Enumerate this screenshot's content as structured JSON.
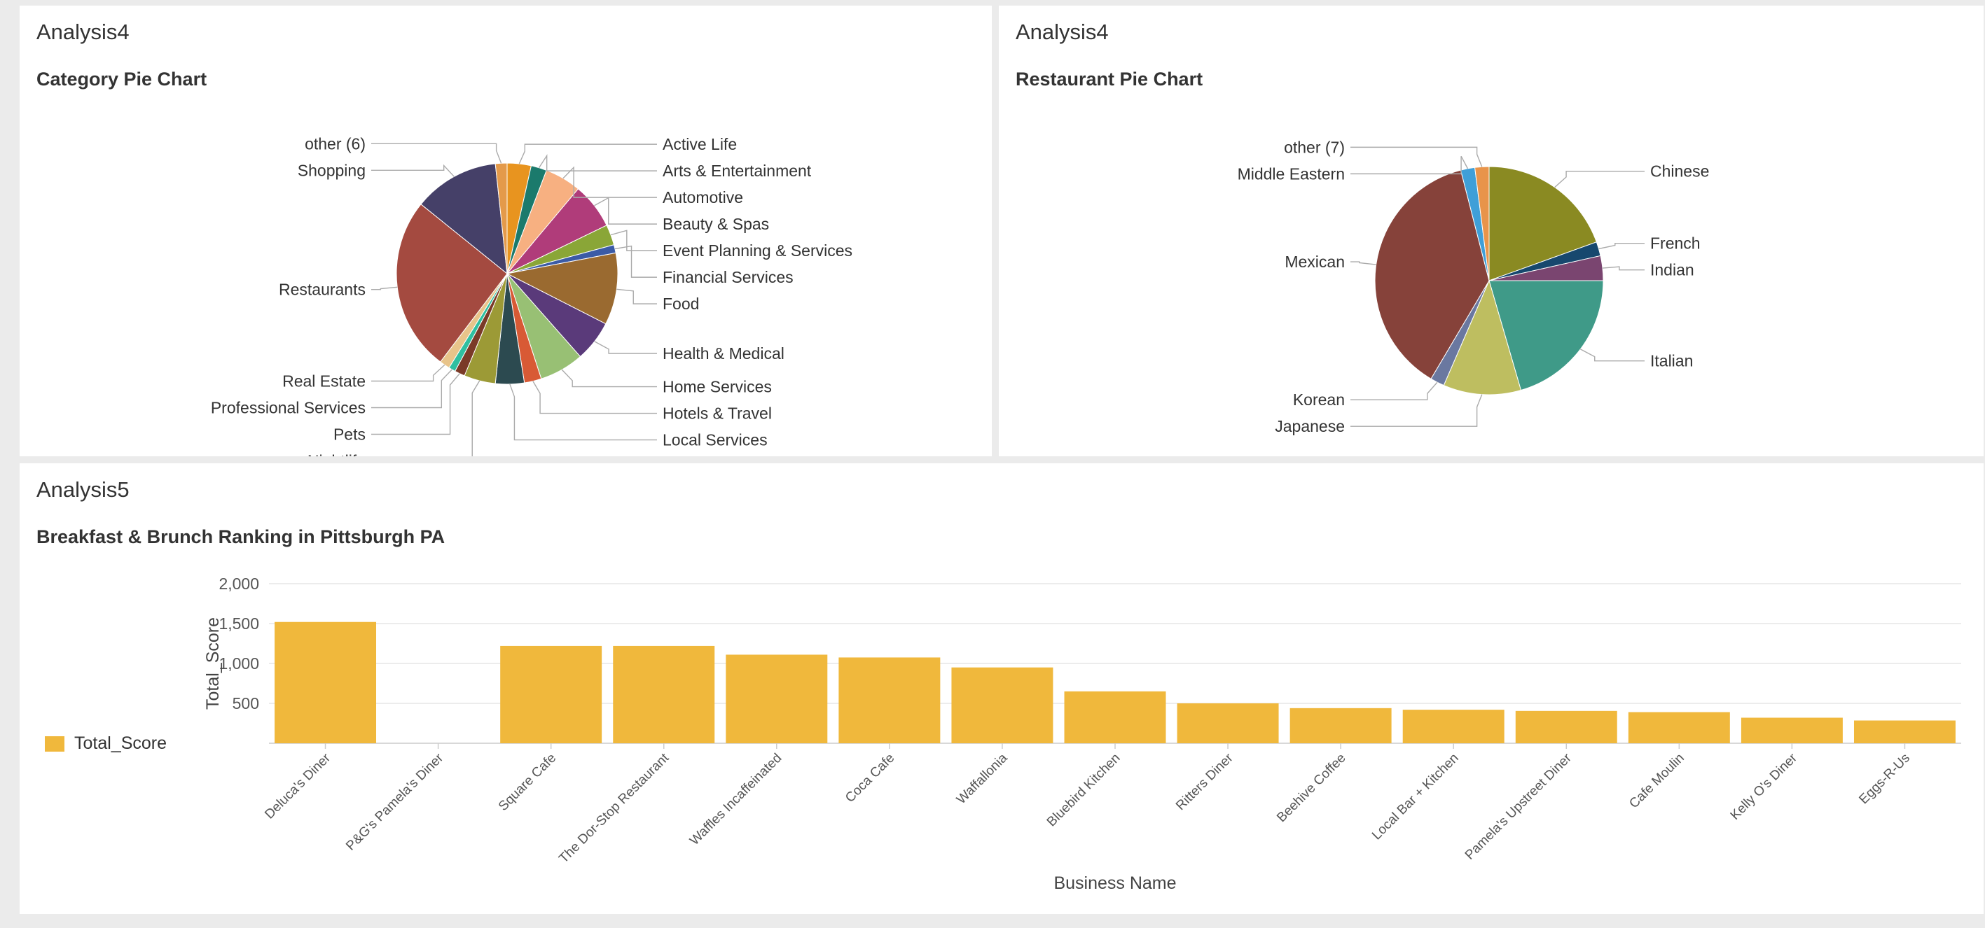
{
  "panels": {
    "category": {
      "header": "Analysis4"
    },
    "restaurant": {
      "header": "Analysis4"
    },
    "ranking": {
      "header": "Analysis5"
    }
  },
  "chart_data": [
    {
      "type": "pie",
      "title": "Category Pie Chart",
      "slices": [
        {
          "label": "Active Life",
          "value": 3.5,
          "color": "#e8941f"
        },
        {
          "label": "Arts & Entertainment",
          "value": 2.3,
          "color": "#1b7a6c"
        },
        {
          "label": "Automotive",
          "value": 5.3,
          "color": "#f7b081"
        },
        {
          "label": "Beauty & Spas",
          "value": 6.7,
          "color": "#b03c7a"
        },
        {
          "label": "Event Planning & Services",
          "value": 3.0,
          "color": "#8aa637"
        },
        {
          "label": "Financial Services",
          "value": 1.2,
          "color": "#3b5ba6"
        },
        {
          "label": "Food",
          "value": 10.5,
          "color": "#9a6a30"
        },
        {
          "label": "Health & Medical",
          "value": 6.0,
          "color": "#5a3a7a"
        },
        {
          "label": "Home Services",
          "value": 6.5,
          "color": "#98c074"
        },
        {
          "label": "Hotels & Travel",
          "value": 2.5,
          "color": "#d85a35"
        },
        {
          "label": "Local Services",
          "value": 4.2,
          "color": "#2c4a50"
        },
        {
          "label": "Nightlife",
          "value": 4.6,
          "color": "#9c9a36"
        },
        {
          "label": "Pets",
          "value": 1.5,
          "color": "#7a3a28"
        },
        {
          "label": "Professional Services",
          "value": 1.0,
          "color": "#2fbfa0"
        },
        {
          "label": "Real Estate",
          "value": 1.5,
          "color": "#e8c48a"
        },
        {
          "label": "Restaurants",
          "value": 25.5,
          "color": "#a44a40"
        },
        {
          "label": "Shopping",
          "value": 12.5,
          "color": "#454068"
        },
        {
          "label": "other (6)",
          "value": 1.7,
          "color": "#e49a4a"
        }
      ]
    },
    {
      "type": "pie",
      "title": "Restaurant Pie Chart",
      "slices": [
        {
          "label": "Chinese",
          "value": 19.5,
          "color": "#8a8a22"
        },
        {
          "label": "French",
          "value": 2.0,
          "color": "#17486e"
        },
        {
          "label": "Indian",
          "value": 3.5,
          "color": "#7a4570"
        },
        {
          "label": "Italian",
          "value": 20.5,
          "color": "#3f9a88"
        },
        {
          "label": "Japanese",
          "value": 11.0,
          "color": "#bebe60"
        },
        {
          "label": "Korean",
          "value": 2.0,
          "color": "#6a78a0"
        },
        {
          "label": "Mexican",
          "value": 37.5,
          "color": "#86423a"
        },
        {
          "label": "Middle Eastern",
          "value": 2.0,
          "color": "#3f9fd8"
        },
        {
          "label": "other (7)",
          "value": 2.0,
          "color": "#e8944a"
        }
      ]
    },
    {
      "type": "bar",
      "title": "Breakfast & Brunch Ranking in Pittsburgh PA",
      "xlabel": "Business Name",
      "ylabel": "Total_Score",
      "ylim": [
        0,
        2000
      ],
      "yticks": [
        500,
        1000,
        1500,
        2000
      ],
      "yticklabels": [
        "500",
        "1,000",
        "1,500",
        "2,000"
      ],
      "grid": true,
      "legend": "left",
      "categories": [
        "Deluca's Diner",
        "P&G's Pamela's Diner",
        "Square Cafe",
        "The Dor-Stop Restaurant",
        "Waffles Incaffeinated",
        "Coca Cafe",
        "Waffallonia",
        "Bluebird Kitchen",
        "Ritters Diner",
        "Beehive Coffee",
        "Local Bar + Kitchen",
        "Pamela's Upstreet Diner",
        "Cafe Moulin",
        "Kelly O's Diner",
        "Eggs-R-Us"
      ],
      "series": [
        {
          "name": "Total_Score",
          "color": "#f0b83c",
          "values": [
            1520,
            0,
            1220,
            1220,
            1110,
            1075,
            950,
            650,
            500,
            440,
            420,
            405,
            390,
            320,
            285
          ]
        }
      ]
    }
  ]
}
